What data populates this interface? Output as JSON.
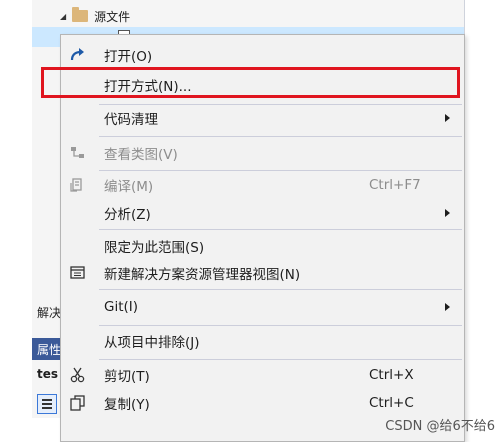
{
  "background": {
    "tree_folder_label": "源文件",
    "panel_label": "解决",
    "properties_header": "属性",
    "properties_name": "tes"
  },
  "menu": {
    "items": [
      {
        "label": "打开(O)",
        "icon": "open-arrow-icon",
        "enabled": true
      },
      {
        "label": "打开方式(N)...",
        "icon": "",
        "enabled": true
      },
      {
        "label": "代码清理",
        "icon": "",
        "enabled": true,
        "submenu": true
      },
      {
        "label": "查看类图(V)",
        "icon": "class-diagram-icon",
        "enabled": false
      },
      {
        "label": "编译(M)",
        "icon": "compile-icon",
        "enabled": false,
        "shortcut": "Ctrl+F7"
      },
      {
        "label": "分析(Z)",
        "icon": "",
        "enabled": true,
        "submenu": true
      },
      {
        "label": "限定为此范围(S)",
        "icon": "",
        "enabled": true
      },
      {
        "label": "新建解决方案资源管理器视图(N)",
        "icon": "new-view-icon",
        "enabled": true
      },
      {
        "label": "Git(I)",
        "icon": "",
        "enabled": true,
        "submenu": true
      },
      {
        "label": "从项目中排除(J)",
        "icon": "",
        "enabled": true
      },
      {
        "label": "剪切(T)",
        "icon": "scissors-icon",
        "enabled": true,
        "shortcut": "Ctrl+X"
      },
      {
        "label": "复制(Y)",
        "icon": "copy-icon",
        "enabled": true,
        "shortcut": "Ctrl+C"
      }
    ]
  },
  "highlight_color": "#e0151f",
  "watermark": "CSDN @给6不给6"
}
